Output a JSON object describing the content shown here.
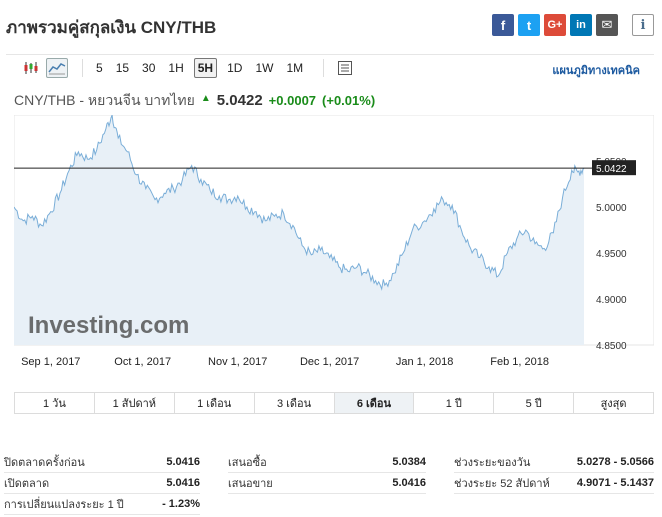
{
  "page": {
    "title": "ภาพรวมคู่สกุลเงิน CNY/THB"
  },
  "share": {
    "facebook": "f",
    "twitter": "t",
    "google": "G+",
    "linkedin": "in",
    "email": "✉",
    "info": "i"
  },
  "toolbar": {
    "chart_types": [
      {
        "icon": "candlestick-icon"
      },
      {
        "icon": "area-chart-icon",
        "active": true
      }
    ],
    "timeframes": [
      "5",
      "15",
      "30",
      "1H",
      "5H",
      "1D",
      "1W",
      "1M"
    ],
    "active_timeframe": "5H",
    "settings_icon": "chart-settings-icon",
    "tech_link": "แผนภูมิทางเทคนิค"
  },
  "quote": {
    "pair": "CNY/THB - หยวนจีน บาทไทย",
    "price": "5.0422",
    "change": "+0.0007",
    "change_pct": "(+0.01%)"
  },
  "chart_data": {
    "type": "area",
    "x_start": "2017-08-20",
    "x_end": "2018-02-22",
    "x_ticks": [
      {
        "label": "Sep 1, 2017",
        "date": "2017-09-01"
      },
      {
        "label": "Oct 1, 2017",
        "date": "2017-10-01"
      },
      {
        "label": "Nov 1, 2017",
        "date": "2017-11-01"
      },
      {
        "label": "Dec 1, 2017",
        "date": "2017-12-01"
      },
      {
        "label": "Jan 1, 2018",
        "date": "2018-01-01"
      },
      {
        "label": "Feb 1, 2018",
        "date": "2018-02-01"
      }
    ],
    "y_ticks": [
      "5.0500",
      "5.0000",
      "4.9500",
      "4.9000",
      "4.8500"
    ],
    "ylim": [
      4.85,
      5.1
    ],
    "current_price_label": "5.0422",
    "current_price": 5.0422,
    "watermark": "Investing.com",
    "line_color": "#7aaed8",
    "fill_color": "#e8f0f7",
    "points": [
      [
        "2017-08-20",
        5.0
      ],
      [
        "2017-08-23",
        4.985
      ],
      [
        "2017-08-26",
        4.99
      ],
      [
        "2017-08-29",
        4.98
      ],
      [
        "2017-09-01",
        4.995
      ],
      [
        "2017-09-04",
        5.015
      ],
      [
        "2017-09-07",
        5.04
      ],
      [
        "2017-09-10",
        5.06
      ],
      [
        "2017-09-13",
        5.052
      ],
      [
        "2017-09-16",
        5.062
      ],
      [
        "2017-09-19",
        5.085
      ],
      [
        "2017-09-21",
        5.1
      ],
      [
        "2017-09-23",
        5.075
      ],
      [
        "2017-09-26",
        5.06
      ],
      [
        "2017-09-29",
        5.035
      ],
      [
        "2017-10-02",
        5.02
      ],
      [
        "2017-10-05",
        5.008
      ],
      [
        "2017-10-08",
        5.015
      ],
      [
        "2017-10-11",
        5.02
      ],
      [
        "2017-10-14",
        5.03
      ],
      [
        "2017-10-17",
        5.045
      ],
      [
        "2017-10-20",
        5.03
      ],
      [
        "2017-10-23",
        5.018
      ],
      [
        "2017-10-26",
        5.012
      ],
      [
        "2017-10-29",
        5.008
      ],
      [
        "2017-11-01",
        5.012
      ],
      [
        "2017-11-04",
        5.0
      ],
      [
        "2017-11-07",
        4.995
      ],
      [
        "2017-11-10",
        4.985
      ],
      [
        "2017-11-13",
        4.99
      ],
      [
        "2017-11-16",
        4.993
      ],
      [
        "2017-11-19",
        4.98
      ],
      [
        "2017-11-22",
        4.958
      ],
      [
        "2017-11-25",
        4.948
      ],
      [
        "2017-11-28",
        4.953
      ],
      [
        "2017-12-01",
        4.945
      ],
      [
        "2017-12-04",
        4.935
      ],
      [
        "2017-12-07",
        4.93
      ],
      [
        "2017-12-10",
        4.935
      ],
      [
        "2017-12-13",
        4.928
      ],
      [
        "2017-12-16",
        4.92
      ],
      [
        "2017-12-19",
        4.915
      ],
      [
        "2017-12-22",
        4.928
      ],
      [
        "2017-12-25",
        4.95
      ],
      [
        "2017-12-28",
        4.975
      ],
      [
        "2018-01-01",
        4.985
      ],
      [
        "2018-01-04",
        4.998
      ],
      [
        "2018-01-07",
        5.008
      ],
      [
        "2018-01-10",
        5.002
      ],
      [
        "2018-01-13",
        4.975
      ],
      [
        "2018-01-16",
        4.955
      ],
      [
        "2018-01-19",
        4.945
      ],
      [
        "2018-01-22",
        4.935
      ],
      [
        "2018-01-25",
        4.925
      ],
      [
        "2018-01-28",
        4.95
      ],
      [
        "2018-01-31",
        4.965
      ],
      [
        "2018-02-03",
        4.975
      ],
      [
        "2018-02-06",
        4.96
      ],
      [
        "2018-02-09",
        4.955
      ],
      [
        "2018-02-12",
        4.972
      ],
      [
        "2018-02-15",
        5.01
      ],
      [
        "2018-02-18",
        5.04
      ],
      [
        "2018-02-20",
        5.038
      ],
      [
        "2018-02-22",
        5.0422
      ]
    ]
  },
  "periods": [
    {
      "label": "1 วัน"
    },
    {
      "label": "1 สัปดาห์"
    },
    {
      "label": "1 เดือน"
    },
    {
      "label": "3 เดือน"
    },
    {
      "label": "6 เดือน",
      "active": true
    },
    {
      "label": "1 ปี"
    },
    {
      "label": "5 ปี"
    },
    {
      "label": "สูงสุด"
    }
  ],
  "stats": {
    "col1": [
      {
        "k": "ปิดตลาดครั้งก่อน",
        "v": "5.0416"
      },
      {
        "k": "เปิดตลาด",
        "v": "5.0416"
      },
      {
        "k": "การเปลี่ยนแปลงระยะ 1 ปี",
        "v": "- 1.23%"
      }
    ],
    "col2": [
      {
        "k": "เสนอซื้อ",
        "v": "5.0384"
      },
      {
        "k": "เสนอขาย",
        "v": "5.0416"
      }
    ],
    "col3": [
      {
        "k": "ช่วงระยะของวัน",
        "v": "5.0278 - 5.0566"
      },
      {
        "k": "ช่วงระยะ 52 สัปดาห์",
        "v": "4.9071 - 5.1437"
      }
    ]
  }
}
